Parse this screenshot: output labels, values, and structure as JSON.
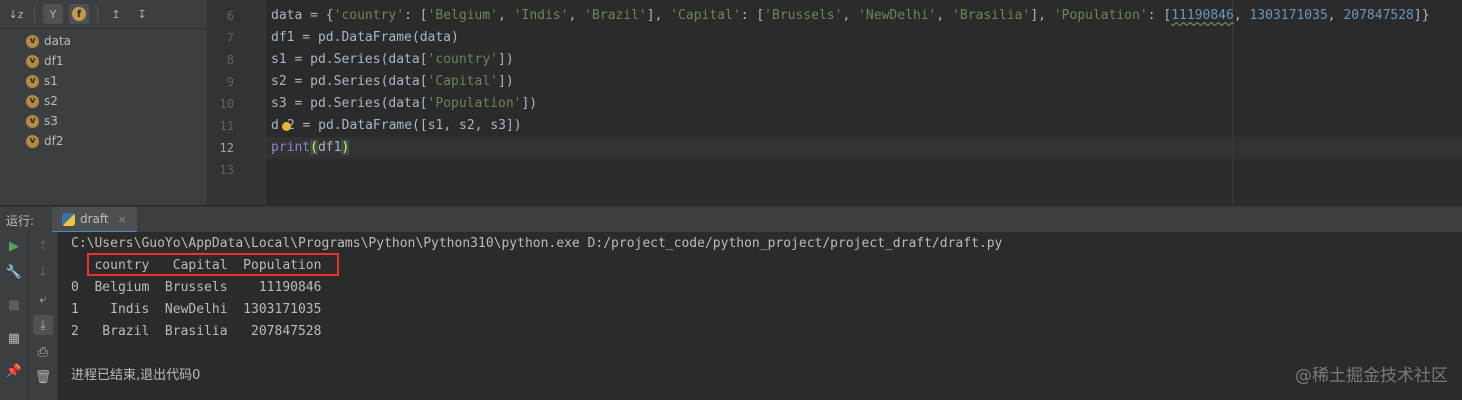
{
  "structure": {
    "toolbar": [
      {
        "glyph": "↓z",
        "name": "sort-alpha-button"
      },
      {
        "glyph": "Y",
        "name": "filter-button"
      },
      {
        "glyph": "f",
        "name": "show-fields-button"
      },
      {
        "glyph": "↥",
        "name": "expand-all-button"
      },
      {
        "glyph": "↧",
        "name": "collapse-all-button"
      }
    ],
    "items": [
      "data",
      "df1",
      "s1",
      "s2",
      "s3",
      "df2"
    ],
    "badge": "v"
  },
  "editor": {
    "line_numbers": [
      "6",
      "7",
      "8",
      "9",
      "10",
      "11",
      "12",
      "13"
    ],
    "current_line": "12",
    "lines": {
      "l6": {
        "p1": "data = {",
        "s1": "'country'",
        "p2": ": [",
        "s2": "'Belgium'",
        "p3": ", ",
        "s3": "'Indis'",
        "p4": ", ",
        "s4": "'Brazil'",
        "p5": "], ",
        "s5": "'Capital'",
        "p6": ": [",
        "s6": "'Brussels'",
        "p7": ", ",
        "s7": "'NewDelhi'",
        "p8": ", ",
        "s8": "'Brasilia'",
        "p9": "], ",
        "s9": "'Population'",
        "p10": ": [",
        "n1": "11190846",
        "p11": ", ",
        "n2": "1303171035",
        "p12": ", ",
        "n3": "207847528",
        "p13": "]}"
      },
      "l7": "df1 = pd.DataFrame(data)",
      "l8": {
        "a": "s1 = pd.Series(data[",
        "s": "'country'",
        "b": "])"
      },
      "l9": {
        "a": "s2 = pd.Series(data[",
        "s": "'Capital'",
        "b": "])"
      },
      "l10": {
        "a": "s3 = pd.Series(data[",
        "s": "'Population'",
        "b": "])"
      },
      "l11": {
        "a": "d",
        "b": "2 = pd.DataFrame([s1, s2, s3])"
      },
      "l12": {
        "fn": "print",
        "open": "(",
        "arg": "df1",
        "close": ")"
      }
    }
  },
  "run": {
    "label": "运行:",
    "tab": "draft",
    "tab_close": "×",
    "left_tools": [
      {
        "glyph": "▶",
        "name": "rerun-button"
      },
      {
        "glyph": "🔧",
        "name": "settings-wrench-button"
      },
      {
        "glyph": "■",
        "name": "stop-button"
      },
      {
        "glyph": "▦",
        "name": "layout-button"
      },
      {
        "glyph": "📌",
        "name": "pin-tab-button"
      }
    ],
    "right_tools": [
      {
        "glyph": "↑",
        "name": "scroll-up-button"
      },
      {
        "glyph": "↓",
        "name": "scroll-down-button"
      },
      {
        "glyph": "⤶",
        "name": "soft-wrap-button"
      },
      {
        "glyph": "⤓",
        "name": "scroll-to-end-button"
      },
      {
        "glyph": "⎙",
        "name": "print-button"
      },
      {
        "glyph": "🗑",
        "name": "clear-all-button"
      }
    ],
    "console": {
      "command": "C:\\Users\\GuoYo\\AppData\\Local\\Programs\\Python\\Python310\\python.exe D:/project_code/python_project/project_draft/draft.py",
      "header": "   country   Capital  Population",
      "rows": [
        "0  Belgium  Brussels    11190846",
        "1    Indis  NewDelhi  1303171035",
        "2   Brazil  Brasilia   207847528"
      ],
      "exit": "进程已结束,退出代码0"
    }
  },
  "watermark": "@稀土掘金技术社区",
  "colors": {
    "string": "#6a8759",
    "number": "#6897bb",
    "builtin": "#8888c6",
    "highlight_box": "#e8332f"
  }
}
